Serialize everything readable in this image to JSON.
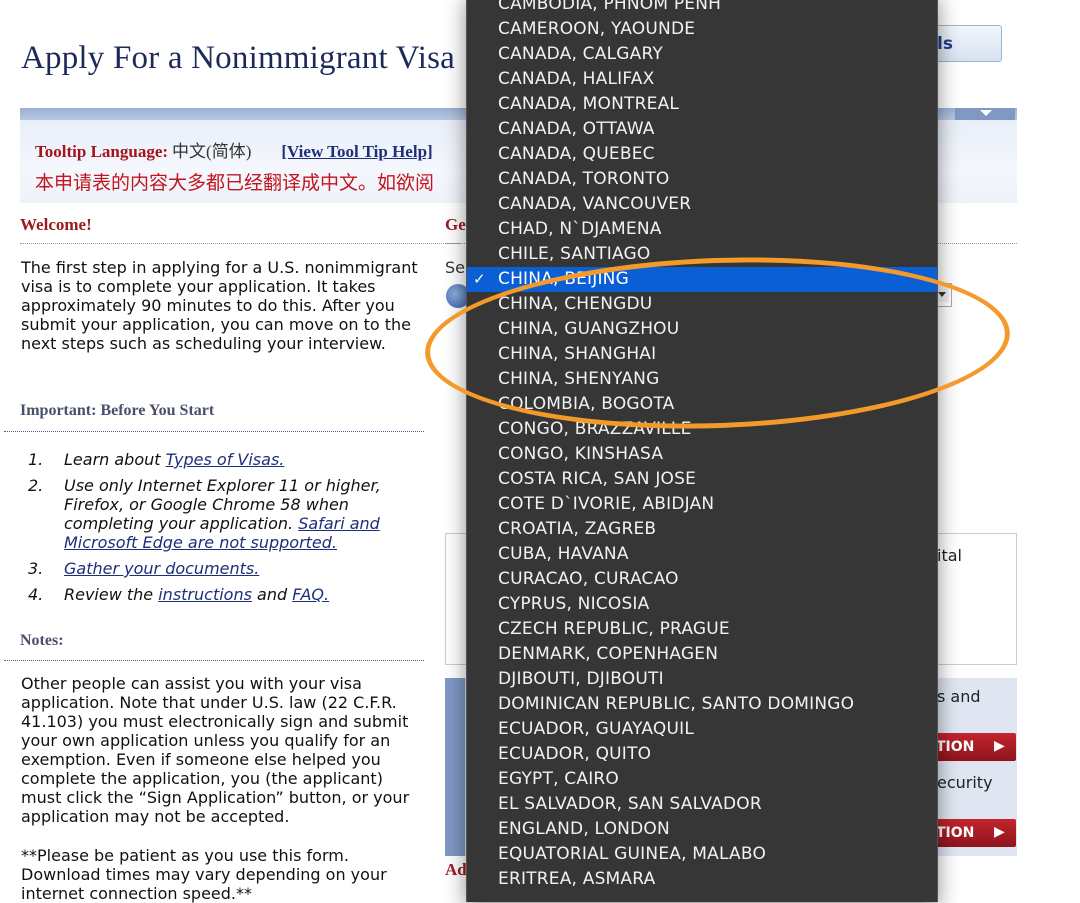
{
  "page": {
    "title": "Apply For a Nonimmigrant Visa",
    "top_button_label": "ls"
  },
  "tooltip": {
    "label": "Tooltip Language:",
    "language": "中文(简体)",
    "help_link": "[View Tool Tip Help]",
    "notice": "本申请表的内容大多都已经翻译成中文。如欲阅"
  },
  "welcome": {
    "heading": "Welcome!",
    "text": "The first step in applying for a U.S. nonimmigrant visa is to complete your application. It takes approximately 90 minutes to do this. After you submit your application, you can move on to the next steps such as scheduling your interview."
  },
  "important": {
    "heading": "Important: Before You Start",
    "items": [
      {
        "num": "1.",
        "pre": "Learn about ",
        "link": "Types of Visas.",
        "mid": "",
        "link2": "",
        "post": ""
      },
      {
        "num": "2.",
        "pre": "Use only Internet Explorer 11 or higher, Firefox, or Google Chrome 58 when completing your application. ",
        "link": "Safari and Microsoft Edge are not supported.",
        "mid": "",
        "link2": "",
        "post": ""
      },
      {
        "num": "3.",
        "pre": "",
        "link": "Gather your documents.",
        "mid": "",
        "link2": "",
        "post": ""
      },
      {
        "num": "4.",
        "pre": "Review the ",
        "link": "instructions",
        "mid": " and ",
        "link2": "FAQ.",
        "post": ""
      }
    ]
  },
  "notes": {
    "heading": "Notes:",
    "text": "Other people can assist you with your visa application. Note that under U.S. law (22 C.F.R. 41.103) you must electronically sign and submit your own application unless you qualify for an exemption. Even if someone else helped you complete the application, you (the applicant) must click the “Sign Application” button, or your application may not be accepted.",
    "patience": "**Please be patient as you use this form. Download times may vary depending on your internet connection speed.**"
  },
  "right": {
    "heading_fragment": "Ge",
    "select_label_fragment": "Se",
    "frag_ital": "ital",
    "frag_and": "s and",
    "frag_security": "ecurity",
    "btn_label": "TION",
    "frag_ad": "Ad"
  },
  "dropdown": {
    "selected": "CHINA, BEIJING",
    "options": [
      "CAMBODIA, PHNOM PENH",
      "CAMEROON, YAOUNDE",
      "CANADA, CALGARY",
      "CANADA, HALIFAX",
      "CANADA, MONTREAL",
      "CANADA, OTTAWA",
      "CANADA, QUEBEC",
      "CANADA, TORONTO",
      "CANADA, VANCOUVER",
      "CHAD, N`DJAMENA",
      "CHILE, SANTIAGO",
      "CHINA, BEIJING",
      "CHINA, CHENGDU",
      "CHINA, GUANGZHOU",
      "CHINA, SHANGHAI",
      "CHINA, SHENYANG",
      "COLOMBIA, BOGOTA",
      "CONGO, BRAZZAVILLE",
      "CONGO, KINSHASA",
      "COSTA RICA, SAN JOSE",
      "COTE D`IVORIE, ABIDJAN",
      "CROATIA, ZAGREB",
      "CUBA, HAVANA",
      "CURACAO, CURACAO",
      "CYPRUS, NICOSIA",
      "CZECH REPUBLIC, PRAGUE",
      "DENMARK, COPENHAGEN",
      "DJIBOUTI, DJIBOUTI",
      "DOMINICAN REPUBLIC, SANTO DOMINGO",
      "ECUADOR, GUAYAQUIL",
      "ECUADOR, QUITO",
      "EGYPT, CAIRO",
      "EL SALVADOR, SAN SALVADOR",
      "ENGLAND, LONDON",
      "EQUATORIAL GUINEA, MALABO",
      "ERITREA, ASMARA"
    ]
  },
  "colors": {
    "title": "#1c2a5b",
    "heading_red": "#9b1b21",
    "link_blue": "#1e2f7a",
    "dropdown_bg": "#363636",
    "selected_bg": "#0b5fd4",
    "annotation_orange": "#f39a2b"
  }
}
